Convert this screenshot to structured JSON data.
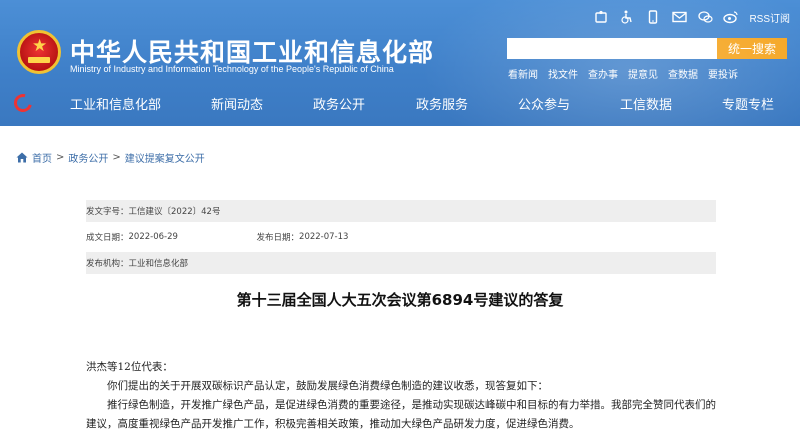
{
  "header": {
    "title": "中华人民共和国工业和信息化部",
    "subtitle": "Ministry of Industry and Information Technology of the People's Republic of China",
    "top_icons": [
      "wechat-official-icon",
      "accessibility-icon",
      "mobile-icon",
      "mail-icon",
      "chat-icon",
      "weibo-icon"
    ],
    "rss_label": "RSS订阅",
    "search_placeholder": "",
    "search_button": "统一搜索",
    "quick_links": [
      "看新闻",
      "找文件",
      "查办事",
      "提意见",
      "查数据",
      "要投诉"
    ],
    "colors": {
      "header_blue": "#3f80c9",
      "search_orange": "#f5a623",
      "emblem_red": "#c01818"
    }
  },
  "nav": {
    "items": [
      "工业和信息化部",
      "新闻动态",
      "政务公开",
      "政务服务",
      "公众参与",
      "工信数据",
      "专题专栏"
    ]
  },
  "breadcrumb": {
    "items": [
      "首页",
      "政务公开",
      "建议提案复文公开"
    ],
    "separator": ">"
  },
  "meta": {
    "doc_number_label": "发文字号：",
    "doc_number": "工信建议〔2022〕42号",
    "written_date_label": "成文日期：",
    "written_date": "2022-06-29",
    "publish_date_label": "发布日期：",
    "publish_date": "2022-07-13",
    "issuer_label": "发布机构：",
    "issuer": "工业和信息化部"
  },
  "document": {
    "title": "第十三届全国人大五次会议第6894号建议的答复",
    "salutation": "洪杰等12位代表：",
    "paragraphs": [
      "你们提出的关于开展双碳标识产品认定，鼓励发展绿色消费绿色制造的建议收悉，现答复如下：",
      "推行绿色制造，开发推广绿色产品，是促进绿色消费的重要途径，是推动实现碳达峰碳中和目标的有力举措。我部完全赞同代表们的建议，高度重视绿色产品开发推广工作，积极完善相关政策，推动加大绿色产品研发力度，促进绿色消费。"
    ]
  }
}
